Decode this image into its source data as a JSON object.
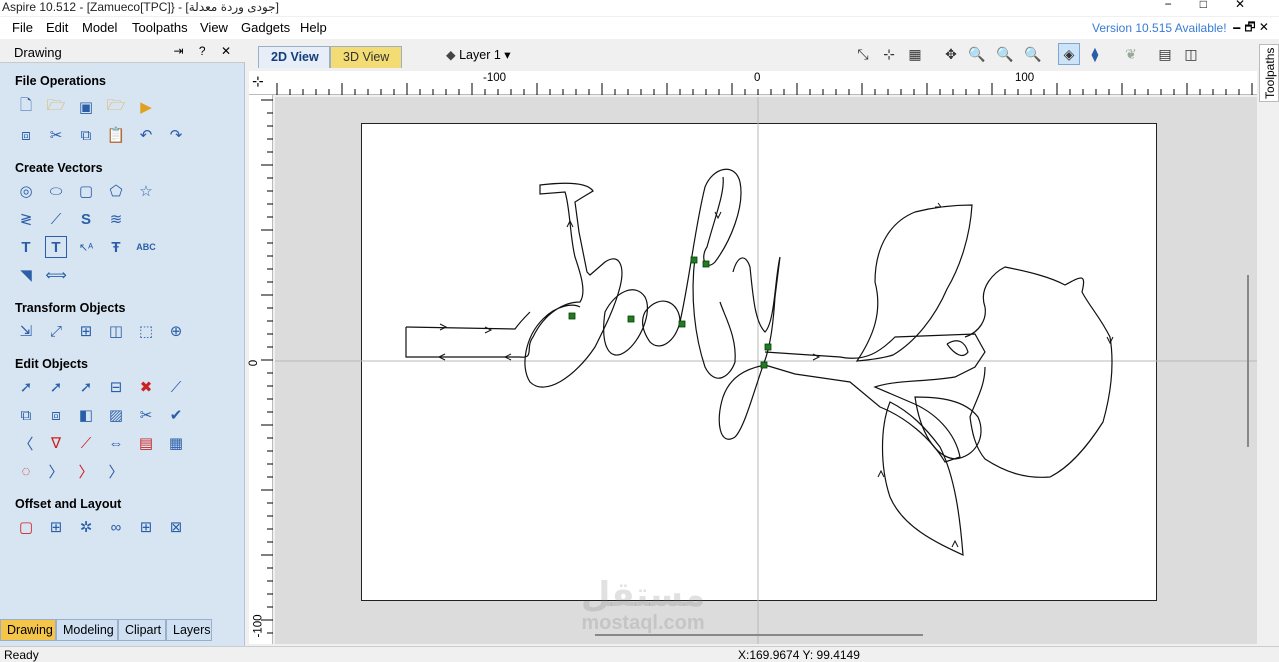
{
  "window": {
    "title": "Aspire 10.512 - [Zamueco[TPC]} - [جودى وردة معدلة]",
    "controls": [
      "−",
      "□",
      "✕"
    ]
  },
  "menu": {
    "items": [
      "File",
      "Edit",
      "Model",
      "Toolpaths",
      "View",
      "Gadgets",
      "Help"
    ],
    "version_notice": "Version 10.515 Available!",
    "mdi_controls": "🗕 🗗 ✕"
  },
  "panel": {
    "title": "Drawing",
    "controls": "⇥ ? ✕",
    "sections": {
      "file_operations": "File Operations",
      "create_vectors": "Create Vectors",
      "transform_objects": "Transform Objects",
      "edit_objects": "Edit Objects",
      "offset_layout": "Offset and Layout"
    },
    "tabs": [
      "Drawing",
      "Modeling",
      "Clipart",
      "Layers"
    ],
    "active_tab": "Drawing"
  },
  "view": {
    "tabs": [
      "2D View",
      "3D View"
    ],
    "active_tab": "2D View",
    "layer": "Layer 1 ▾"
  },
  "side_tab": "Toolpaths",
  "rulers": {
    "top_labels": [
      "-100",
      "0",
      "100"
    ],
    "left_labels": [
      "0",
      "-100"
    ]
  },
  "watermark": {
    "line1": "مستقل",
    "line2": "mostaql.com"
  },
  "status": {
    "text": "Ready",
    "coordinates": "X:169.9674 Y: 99.4149"
  },
  "colors": {
    "panel_bg": "#d7e4f2",
    "active_tab": "#f5c54a",
    "version_link": "#3a7bd5",
    "node_green": "#1e7d1e"
  }
}
